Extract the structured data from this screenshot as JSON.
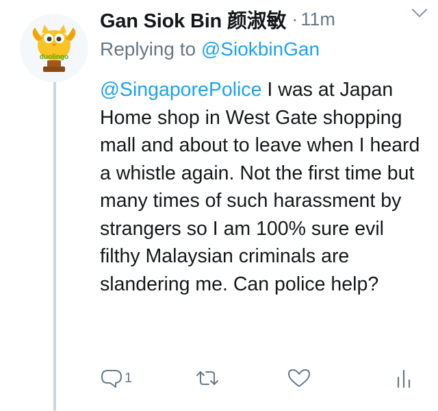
{
  "tweet": {
    "display_name": "Gan Siok Bin 颜淑敏",
    "separator": "·",
    "timestamp": "11m",
    "replying_prefix": "Replying to",
    "replying_handle": "@SiokbinGan",
    "mention": "@SingaporePolice",
    "body": " I was at Japan Home shop in West Gate shopping mall and about to leave when I heard a whistle again. Not the first time but many times of such harassment by strangers so I am 100% sure evil filthy Malaysian criminals are slandering me. Can police help?"
  },
  "avatar": {
    "logo_text": "duolingo",
    "colors": {
      "owl": "#f7c325",
      "wing": "#f0a400",
      "trophy": "#a0591b",
      "text": "#58a700"
    }
  },
  "actions": {
    "reply_count": "1",
    "icons": [
      "reply-icon",
      "retweet-icon",
      "like-icon",
      "analytics-icon"
    ]
  },
  "colors": {
    "link": "#1da1f2",
    "muted": "#657786",
    "text": "#14171a",
    "thread_line": "#ccd6dd"
  }
}
